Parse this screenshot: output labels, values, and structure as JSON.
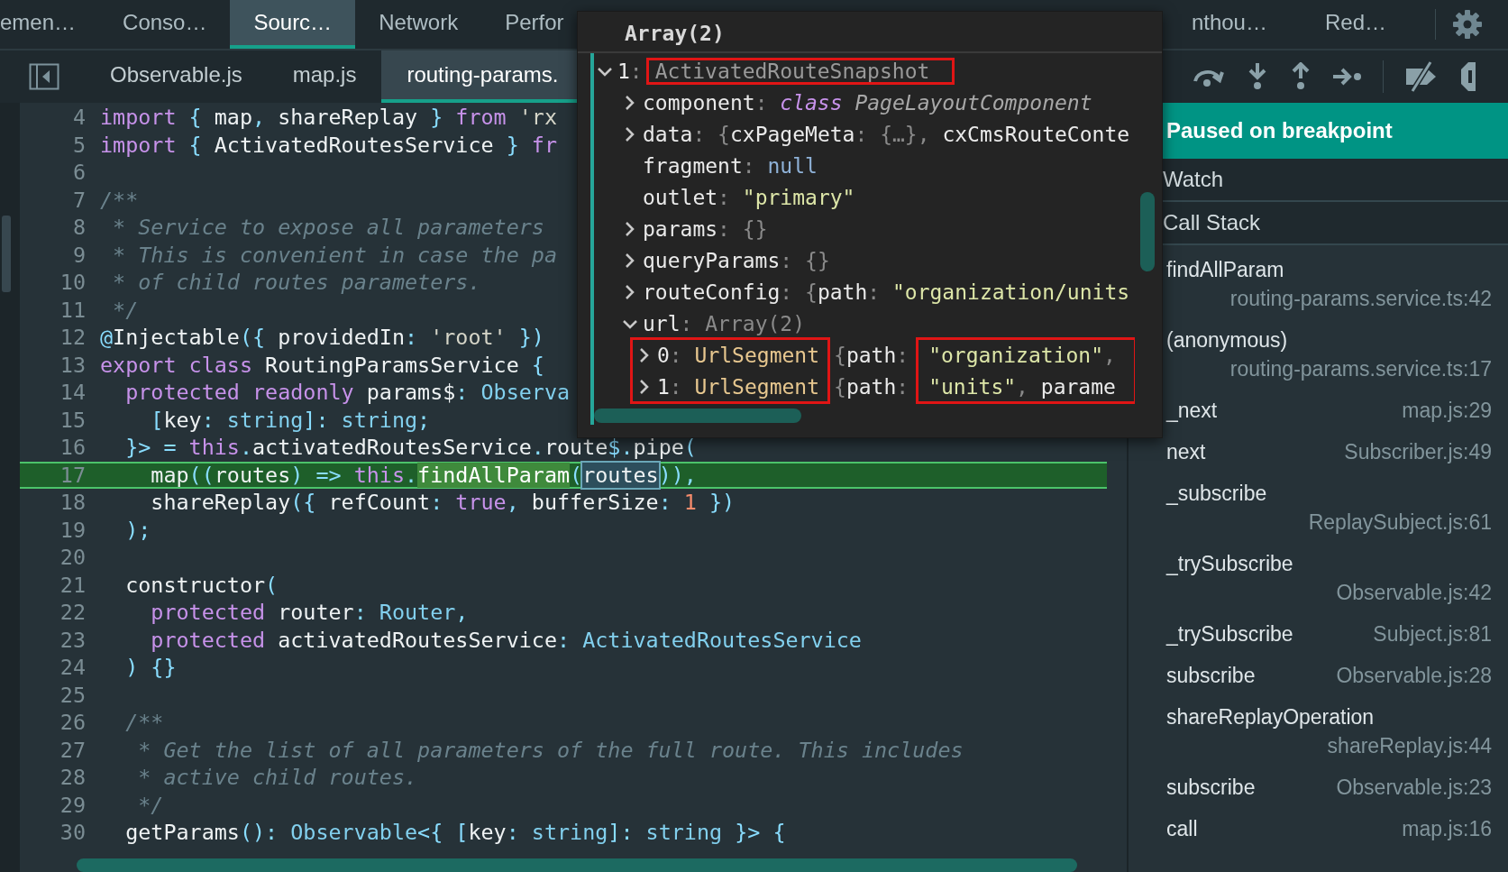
{
  "top_tabs": [
    {
      "label": "emen…",
      "selected": false
    },
    {
      "label": "Conso…",
      "selected": false
    },
    {
      "label": "Sourc…",
      "selected": true
    },
    {
      "label": "Network",
      "selected": false
    },
    {
      "label": "Perfor",
      "selected": false
    }
  ],
  "top_tabs_right": [
    {
      "label": "nthou…",
      "selected": false
    },
    {
      "label": "Red…",
      "selected": false
    }
  ],
  "file_tabs": [
    {
      "label": "Observable.js",
      "selected": false
    },
    {
      "label": "map.js",
      "selected": false
    },
    {
      "label": "routing-params.",
      "selected": true
    }
  ],
  "code": [
    {
      "n": "4",
      "current": false,
      "tokens": [
        {
          "t": "import",
          "kind": "keyword"
        },
        {
          "t": " { ",
          "kind": "punct"
        },
        {
          "t": "map",
          "kind": "plain"
        },
        {
          "t": ", ",
          "kind": "punct"
        },
        {
          "t": "shareReplay",
          "kind": "plain"
        },
        {
          "t": " } ",
          "kind": "punct"
        },
        {
          "t": "from",
          "kind": "keyword"
        },
        {
          "t": " 'rx",
          "kind": "string"
        }
      ]
    },
    {
      "n": "5",
      "current": false,
      "tokens": [
        {
          "t": "import",
          "kind": "keyword"
        },
        {
          "t": " { ",
          "kind": "punct"
        },
        {
          "t": "ActivatedRoutesService",
          "kind": "plain"
        },
        {
          "t": " } ",
          "kind": "punct"
        },
        {
          "t": "fr",
          "kind": "keyword"
        }
      ]
    },
    {
      "n": "6",
      "current": false
    },
    {
      "n": "7",
      "current": false,
      "tokens": [
        {
          "t": "/**",
          "kind": "comment"
        }
      ]
    },
    {
      "n": "8",
      "current": false,
      "tokens": [
        {
          "t": " * Service to expose all parameters",
          "kind": "comment"
        }
      ]
    },
    {
      "n": "9",
      "current": false,
      "tokens": [
        {
          "t": " * This is convenient in case the pa",
          "kind": "comment"
        }
      ]
    },
    {
      "n": "10",
      "current": false,
      "tokens": [
        {
          "t": " * of child routes parameters.",
          "kind": "comment"
        }
      ]
    },
    {
      "n": "11",
      "current": false,
      "tokens": [
        {
          "t": " */",
          "kind": "comment"
        }
      ]
    },
    {
      "n": "12",
      "current": false,
      "tokens": [
        {
          "t": "@",
          "kind": "punct"
        },
        {
          "t": "Injectable",
          "kind": "plain"
        },
        {
          "t": "({ ",
          "kind": "punct"
        },
        {
          "t": "providedIn",
          "kind": "plain"
        },
        {
          "t": ": ",
          "kind": "punct"
        },
        {
          "t": "'root'",
          "kind": "string"
        },
        {
          "t": " })",
          "kind": "punct"
        }
      ]
    },
    {
      "n": "13",
      "current": false,
      "tokens": [
        {
          "t": "export class ",
          "kind": "keyword"
        },
        {
          "t": "RoutingParamsService ",
          "kind": "plain"
        },
        {
          "t": "{",
          "kind": "punct"
        }
      ]
    },
    {
      "n": "14",
      "current": false,
      "tokens": [
        {
          "t": "  protected readonly ",
          "kind": "keyword"
        },
        {
          "t": "params$",
          "kind": "plain"
        },
        {
          "t": ": ",
          "kind": "punct"
        },
        {
          "t": "Observa",
          "kind": "type"
        }
      ]
    },
    {
      "n": "15",
      "current": false,
      "tokens": [
        {
          "t": "    [",
          "kind": "punct"
        },
        {
          "t": "key",
          "kind": "plain"
        },
        {
          "t": ": ",
          "kind": "punct"
        },
        {
          "t": "string",
          "kind": "type"
        },
        {
          "t": "]: ",
          "kind": "punct"
        },
        {
          "t": "string",
          "kind": "type"
        },
        {
          "t": ";",
          "kind": "punct"
        }
      ]
    },
    {
      "n": "16",
      "current": false,
      "tokens": [
        {
          "t": "  }> = ",
          "kind": "punct"
        },
        {
          "t": "this",
          "kind": "keyword"
        },
        {
          "t": ".",
          "kind": "punct"
        },
        {
          "t": "activatedRoutesService",
          "kind": "plain"
        },
        {
          "t": ".",
          "kind": "punct"
        },
        {
          "t": "route",
          "kind": "plain"
        },
        {
          "t": "$.",
          "kind": "punct"
        },
        {
          "t": "pipe",
          "kind": "plain"
        },
        {
          "t": "(",
          "kind": "punct"
        }
      ]
    },
    {
      "n": "17",
      "current": true,
      "tokens": [
        {
          "t": "    map",
          "kind": "plain"
        },
        {
          "t": "((",
          "kind": "punct"
        },
        {
          "t": "routes",
          "kind": "plain"
        },
        {
          "t": ") => ",
          "kind": "punct"
        },
        {
          "t": "this",
          "kind": "keyword"
        },
        {
          "t": ".",
          "kind": "punct"
        },
        {
          "t": "findAllParam",
          "kind": "call"
        },
        {
          "t": "(",
          "kind": "punct"
        },
        {
          "t": "routes",
          "kind": "hovered"
        },
        {
          "t": ")),",
          "kind": "punct"
        }
      ]
    },
    {
      "n": "18",
      "current": false,
      "tokens": [
        {
          "t": "    shareReplay",
          "kind": "plain"
        },
        {
          "t": "({ ",
          "kind": "punct"
        },
        {
          "t": "refCount",
          "kind": "plain"
        },
        {
          "t": ": ",
          "kind": "punct"
        },
        {
          "t": "true",
          "kind": "keyword"
        },
        {
          "t": ", ",
          "kind": "punct"
        },
        {
          "t": "bufferSize",
          "kind": "plain"
        },
        {
          "t": ": ",
          "kind": "punct"
        },
        {
          "t": "1",
          "kind": "number"
        },
        {
          "t": " })",
          "kind": "punct"
        }
      ]
    },
    {
      "n": "19",
      "current": false,
      "tokens": [
        {
          "t": "  );",
          "kind": "punct"
        }
      ]
    },
    {
      "n": "20",
      "current": false
    },
    {
      "n": "21",
      "current": false,
      "tokens": [
        {
          "t": "  constructor",
          "kind": "plain"
        },
        {
          "t": "(",
          "kind": "punct"
        }
      ]
    },
    {
      "n": "22",
      "current": false,
      "tokens": [
        {
          "t": "    protected ",
          "kind": "keyword"
        },
        {
          "t": "router",
          "kind": "plain"
        },
        {
          "t": ": ",
          "kind": "punct"
        },
        {
          "t": "Router",
          "kind": "type"
        },
        {
          "t": ",",
          "kind": "punct"
        }
      ]
    },
    {
      "n": "23",
      "current": false,
      "tokens": [
        {
          "t": "    protected ",
          "kind": "keyword"
        },
        {
          "t": "activatedRoutesService",
          "kind": "plain"
        },
        {
          "t": ": ",
          "kind": "punct"
        },
        {
          "t": "ActivatedRoutesService",
          "kind": "type"
        }
      ]
    },
    {
      "n": "24",
      "current": false,
      "tokens": [
        {
          "t": "  ) {}",
          "kind": "punct"
        }
      ]
    },
    {
      "n": "25",
      "current": false
    },
    {
      "n": "26",
      "current": false,
      "tokens": [
        {
          "t": "  /**",
          "kind": "comment"
        }
      ]
    },
    {
      "n": "27",
      "current": false,
      "tokens": [
        {
          "t": "   * Get the list of all parameters of the full route. This includes",
          "kind": "comment"
        }
      ]
    },
    {
      "n": "28",
      "current": false,
      "tokens": [
        {
          "t": "   * active child routes.",
          "kind": "comment"
        }
      ]
    },
    {
      "n": "29",
      "current": false,
      "tokens": [
        {
          "t": "   */",
          "kind": "comment"
        }
      ]
    },
    {
      "n": "30",
      "current": false,
      "tokens": [
        {
          "t": "  getParams",
          "kind": "plain"
        },
        {
          "t": "(): ",
          "kind": "punct"
        },
        {
          "t": "Observable",
          "kind": "type"
        },
        {
          "t": "<{ [",
          "kind": "punct"
        },
        {
          "t": "key",
          "kind": "plain"
        },
        {
          "t": ": ",
          "kind": "punct"
        },
        {
          "t": "string",
          "kind": "type"
        },
        {
          "t": "]: ",
          "kind": "punct"
        },
        {
          "t": "string",
          "kind": "type"
        },
        {
          "t": " }> {",
          "kind": "punct"
        }
      ]
    }
  ],
  "popup": {
    "title": "Array(2)",
    "item": {
      "label": [
        {
          "t": "1",
          "kind": "plain"
        },
        {
          "t": ":",
          "kind": "punct"
        }
      ],
      "type": "ActivatedRouteSnapshot",
      "expanded": true,
      "highlighted": true,
      "props": [
        {
          "expanded": false,
          "parts": [
            {
              "t": "component",
              "kind": "plain"
            },
            {
              "t": ": ",
              "kind": "punct"
            },
            {
              "t": "class",
              "kind": "keyword"
            },
            {
              "t": " PageLayoutComponent",
              "kind": "classname"
            }
          ]
        },
        {
          "expanded": false,
          "parts": [
            {
              "t": "data",
              "kind": "plain"
            },
            {
              "t": ": ",
              "kind": "punct"
            },
            {
              "t": "{",
              "kind": "punct"
            },
            {
              "t": "cxPageMeta",
              "kind": "plain"
            },
            {
              "t": ": ",
              "kind": "punct"
            },
            {
              "t": "{…}",
              "kind": "punct"
            },
            {
              "t": ", ",
              "kind": "punct"
            },
            {
              "t": "cxCmsRouteConte",
              "kind": "plain"
            }
          ]
        },
        {
          "parts": [
            {
              "t": "fragment",
              "kind": "plain"
            },
            {
              "t": ": ",
              "kind": "punct"
            },
            {
              "t": "null",
              "kind": "null"
            }
          ]
        },
        {
          "parts": [
            {
              "t": "outlet",
              "kind": "plain"
            },
            {
              "t": ": ",
              "kind": "punct"
            },
            {
              "t": "\"primary\"",
              "kind": "string"
            }
          ]
        },
        {
          "expanded": false,
          "parts": [
            {
              "t": "params",
              "kind": "plain"
            },
            {
              "t": ": ",
              "kind": "punct"
            },
            {
              "t": "{}",
              "kind": "punct"
            }
          ]
        },
        {
          "expanded": false,
          "parts": [
            {
              "t": "queryParams",
              "kind": "plain"
            },
            {
              "t": ": ",
              "kind": "punct"
            },
            {
              "t": "{}",
              "kind": "punct"
            }
          ]
        },
        {
          "expanded": false,
          "parts": [
            {
              "t": "routeConfig",
              "kind": "plain"
            },
            {
              "t": ": ",
              "kind": "punct"
            },
            {
              "t": "{",
              "kind": "punct"
            },
            {
              "t": "path",
              "kind": "plain"
            },
            {
              "t": ": ",
              "kind": "punct"
            },
            {
              "t": "\"organization/units",
              "kind": "string"
            }
          ]
        },
        {
          "expanded": true,
          "parts": [
            {
              "t": "url",
              "kind": "plain"
            },
            {
              "t": ": ",
              "kind": "punct"
            },
            {
              "t": "Array(2)",
              "kind": "dim"
            }
          ]
        }
      ],
      "url_items": {
        "highlight_types": true,
        "highlight_values": true,
        "rows": [
          {
            "expanded": false,
            "label": [
              {
                "t": "0",
                "kind": "plain"
              },
              {
                "t": ": ",
                "kind": "punct"
              },
              {
                "t": "UrlSegment",
                "kind": "segment"
              }
            ],
            "key": [
              {
                "t": "{",
                "kind": "punct"
              },
              {
                "t": "path",
                "kind": "plain"
              },
              {
                "t": ":",
                "kind": "punct"
              }
            ],
            "value": [
              {
                "t": "\"organization\"",
                "kind": "string"
              },
              {
                "t": ",",
                "kind": "punct"
              }
            ]
          },
          {
            "expanded": false,
            "label": [
              {
                "t": "1",
                "kind": "plain"
              },
              {
                "t": ": ",
                "kind": "punct"
              },
              {
                "t": "UrlSegment",
                "kind": "segment"
              }
            ],
            "key": [
              {
                "t": "{",
                "kind": "punct"
              },
              {
                "t": "path",
                "kind": "plain"
              },
              {
                "t": ":",
                "kind": "punct"
              }
            ],
            "value": [
              {
                "t": "\"units\"",
                "kind": "string"
              },
              {
                "t": ", ",
                "kind": "punct"
              },
              {
                "t": "parame",
                "kind": "plain"
              }
            ]
          }
        ]
      }
    }
  },
  "debugger": {
    "status": "Paused on breakpoint",
    "sections": [
      {
        "title": "Watch"
      },
      {
        "title": "Call Stack"
      }
    ],
    "call_stack": [
      {
        "name": "findAllParam",
        "location": "routing-params.service.ts:42"
      },
      {
        "name": "(anonymous)",
        "location": "routing-params.service.ts:17"
      },
      {
        "name": "_next",
        "location": "map.js:29"
      },
      {
        "name": "next",
        "location": "Subscriber.js:49"
      },
      {
        "name": "_subscribe",
        "location": "ReplaySubject.js:61"
      },
      {
        "name": "_trySubscribe",
        "location": "Observable.js:42"
      },
      {
        "name": "_trySubscribe",
        "location": "Subject.js:81"
      },
      {
        "name": "subscribe",
        "location": "Observable.js:28"
      },
      {
        "name": "shareReplayOperation",
        "location": "shareReplay.js:44"
      },
      {
        "name": "subscribe",
        "location": "Observable.js:23"
      },
      {
        "name": "call",
        "location": "map.js:16"
      }
    ]
  }
}
